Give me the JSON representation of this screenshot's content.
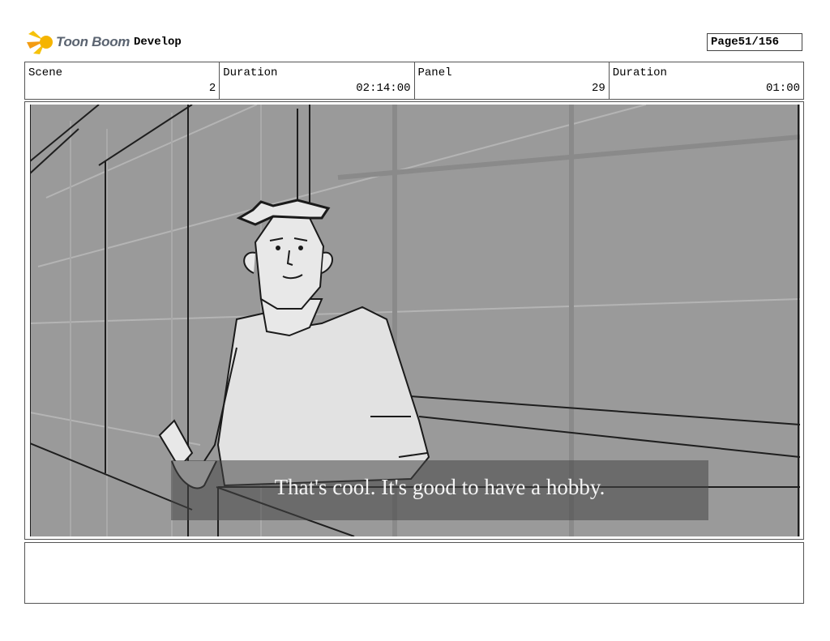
{
  "header": {
    "logo_text": "Toon Boom",
    "project": "Develop",
    "page_label": "Page",
    "page_value": "51/156"
  },
  "info": {
    "scene_label": "Scene",
    "scene_value": "2",
    "scene_duration_label": "Duration",
    "scene_duration_value": "02:14:00",
    "panel_label": "Panel",
    "panel_value": "29",
    "panel_duration_label": "Duration",
    "panel_duration_value": "01:00"
  },
  "panel": {
    "subtitle": "That's cool. It's good to have a hobby."
  },
  "notes": {
    "text": ""
  }
}
